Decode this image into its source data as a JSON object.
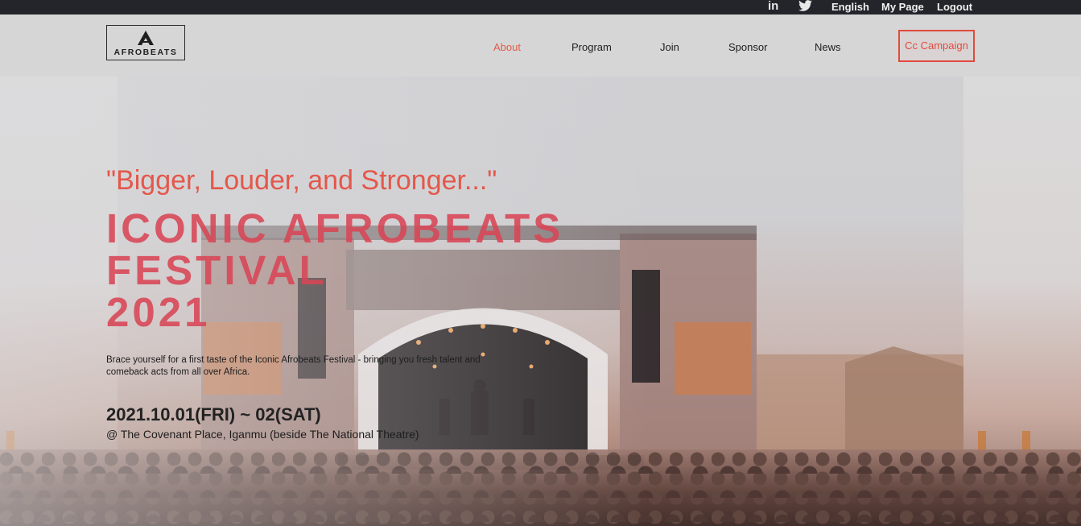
{
  "topbar": {
    "linkedin_icon": "in",
    "twitter_icon": "twitter-bird",
    "links": [
      "English",
      "My Page",
      "Logout"
    ]
  },
  "header": {
    "logo_text": "AFROBEATS",
    "nav": [
      "About",
      "Program",
      "Join",
      "Sponsor",
      "News"
    ],
    "cta": "Cc Campaign",
    "active_color": "#e25b4a",
    "cta_color": "#e14a3e"
  },
  "hero": {
    "quote": "\"Bigger, Louder, and Stronger...\"",
    "title_lines": [
      "ICONIC AFROBEATS",
      "FESTIVAL",
      "2021"
    ],
    "description": "Brace yourself for a first taste of the Iconic Afrobeats Festival - bringing you fresh talent and comeback acts from all over Africa.",
    "date": "2021.10.01(FRI) ~ 02(SAT)",
    "venue": "@ The Covenant Place, Iganmu (beside The National Theatre)",
    "accent_color": "#e4574a"
  }
}
